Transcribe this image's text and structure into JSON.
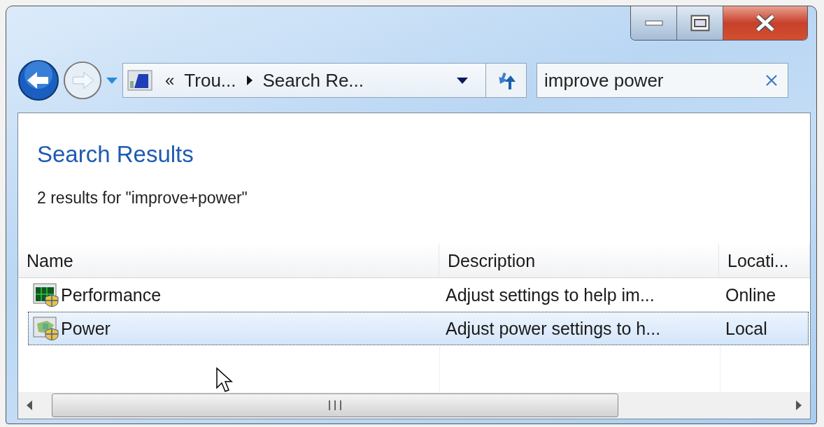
{
  "address_bar": {
    "overflow_glyph": "«",
    "crumbs": [
      "Trou...",
      "Search Re..."
    ]
  },
  "search": {
    "value": "improve power"
  },
  "content": {
    "title": "Search Results",
    "summary": "2 results for \"improve+power\""
  },
  "table": {
    "columns": [
      "Name",
      "Description",
      "Locati..."
    ],
    "rows": [
      {
        "name": "Performance",
        "description": "Adjust settings to help im...",
        "location": "Online",
        "kind": "performance",
        "selected": false
      },
      {
        "name": "Power",
        "description": "Adjust power settings to h...",
        "location": "Local",
        "kind": "power",
        "selected": true
      }
    ]
  }
}
